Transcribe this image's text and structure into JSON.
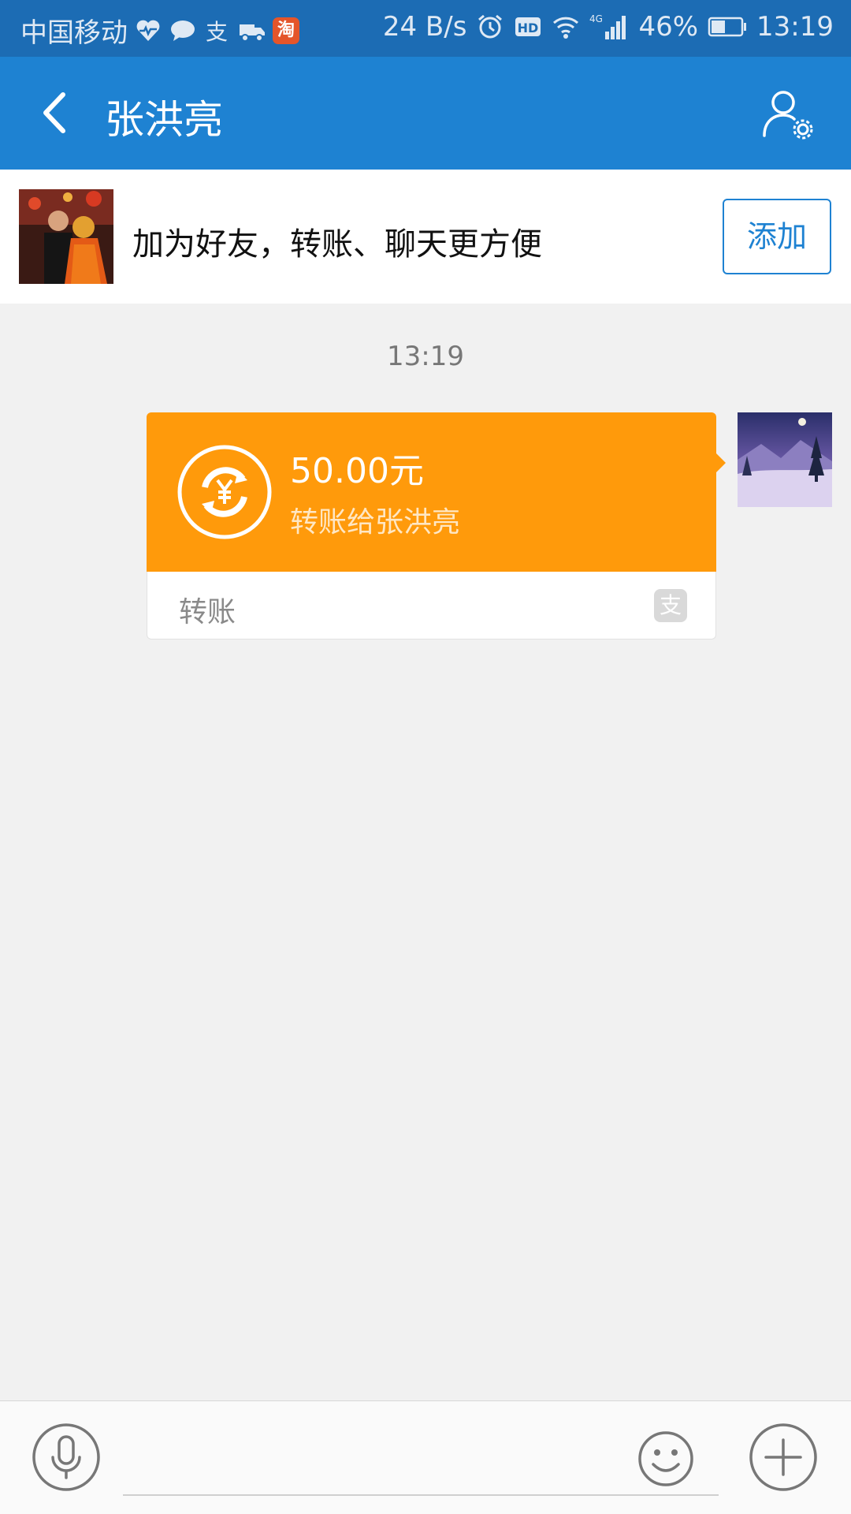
{
  "status_bar": {
    "carrier": "中国移动",
    "net_speed": "24 B/s",
    "hd_label": "HD",
    "network_type": "4G",
    "battery": "46%",
    "time": "13:19",
    "taobao_badge": "淘"
  },
  "header": {
    "title": "张洪亮"
  },
  "friend_banner": {
    "text": "加为好友，转账、聊天更方便",
    "add_label": "添加"
  },
  "chat": {
    "timestamp": "13:19",
    "messages": [
      {
        "type": "transfer",
        "amount": "50.00元",
        "description": "转账给张洪亮",
        "footer_label": "转账",
        "footer_icon_text": "支"
      }
    ]
  },
  "input_bar": {
    "placeholder": ""
  },
  "colors": {
    "status_bar": "#1c6cb4",
    "app_bar": "#1e82d2",
    "transfer_card": "#ff9a0b",
    "background": "#f1f1f1"
  }
}
